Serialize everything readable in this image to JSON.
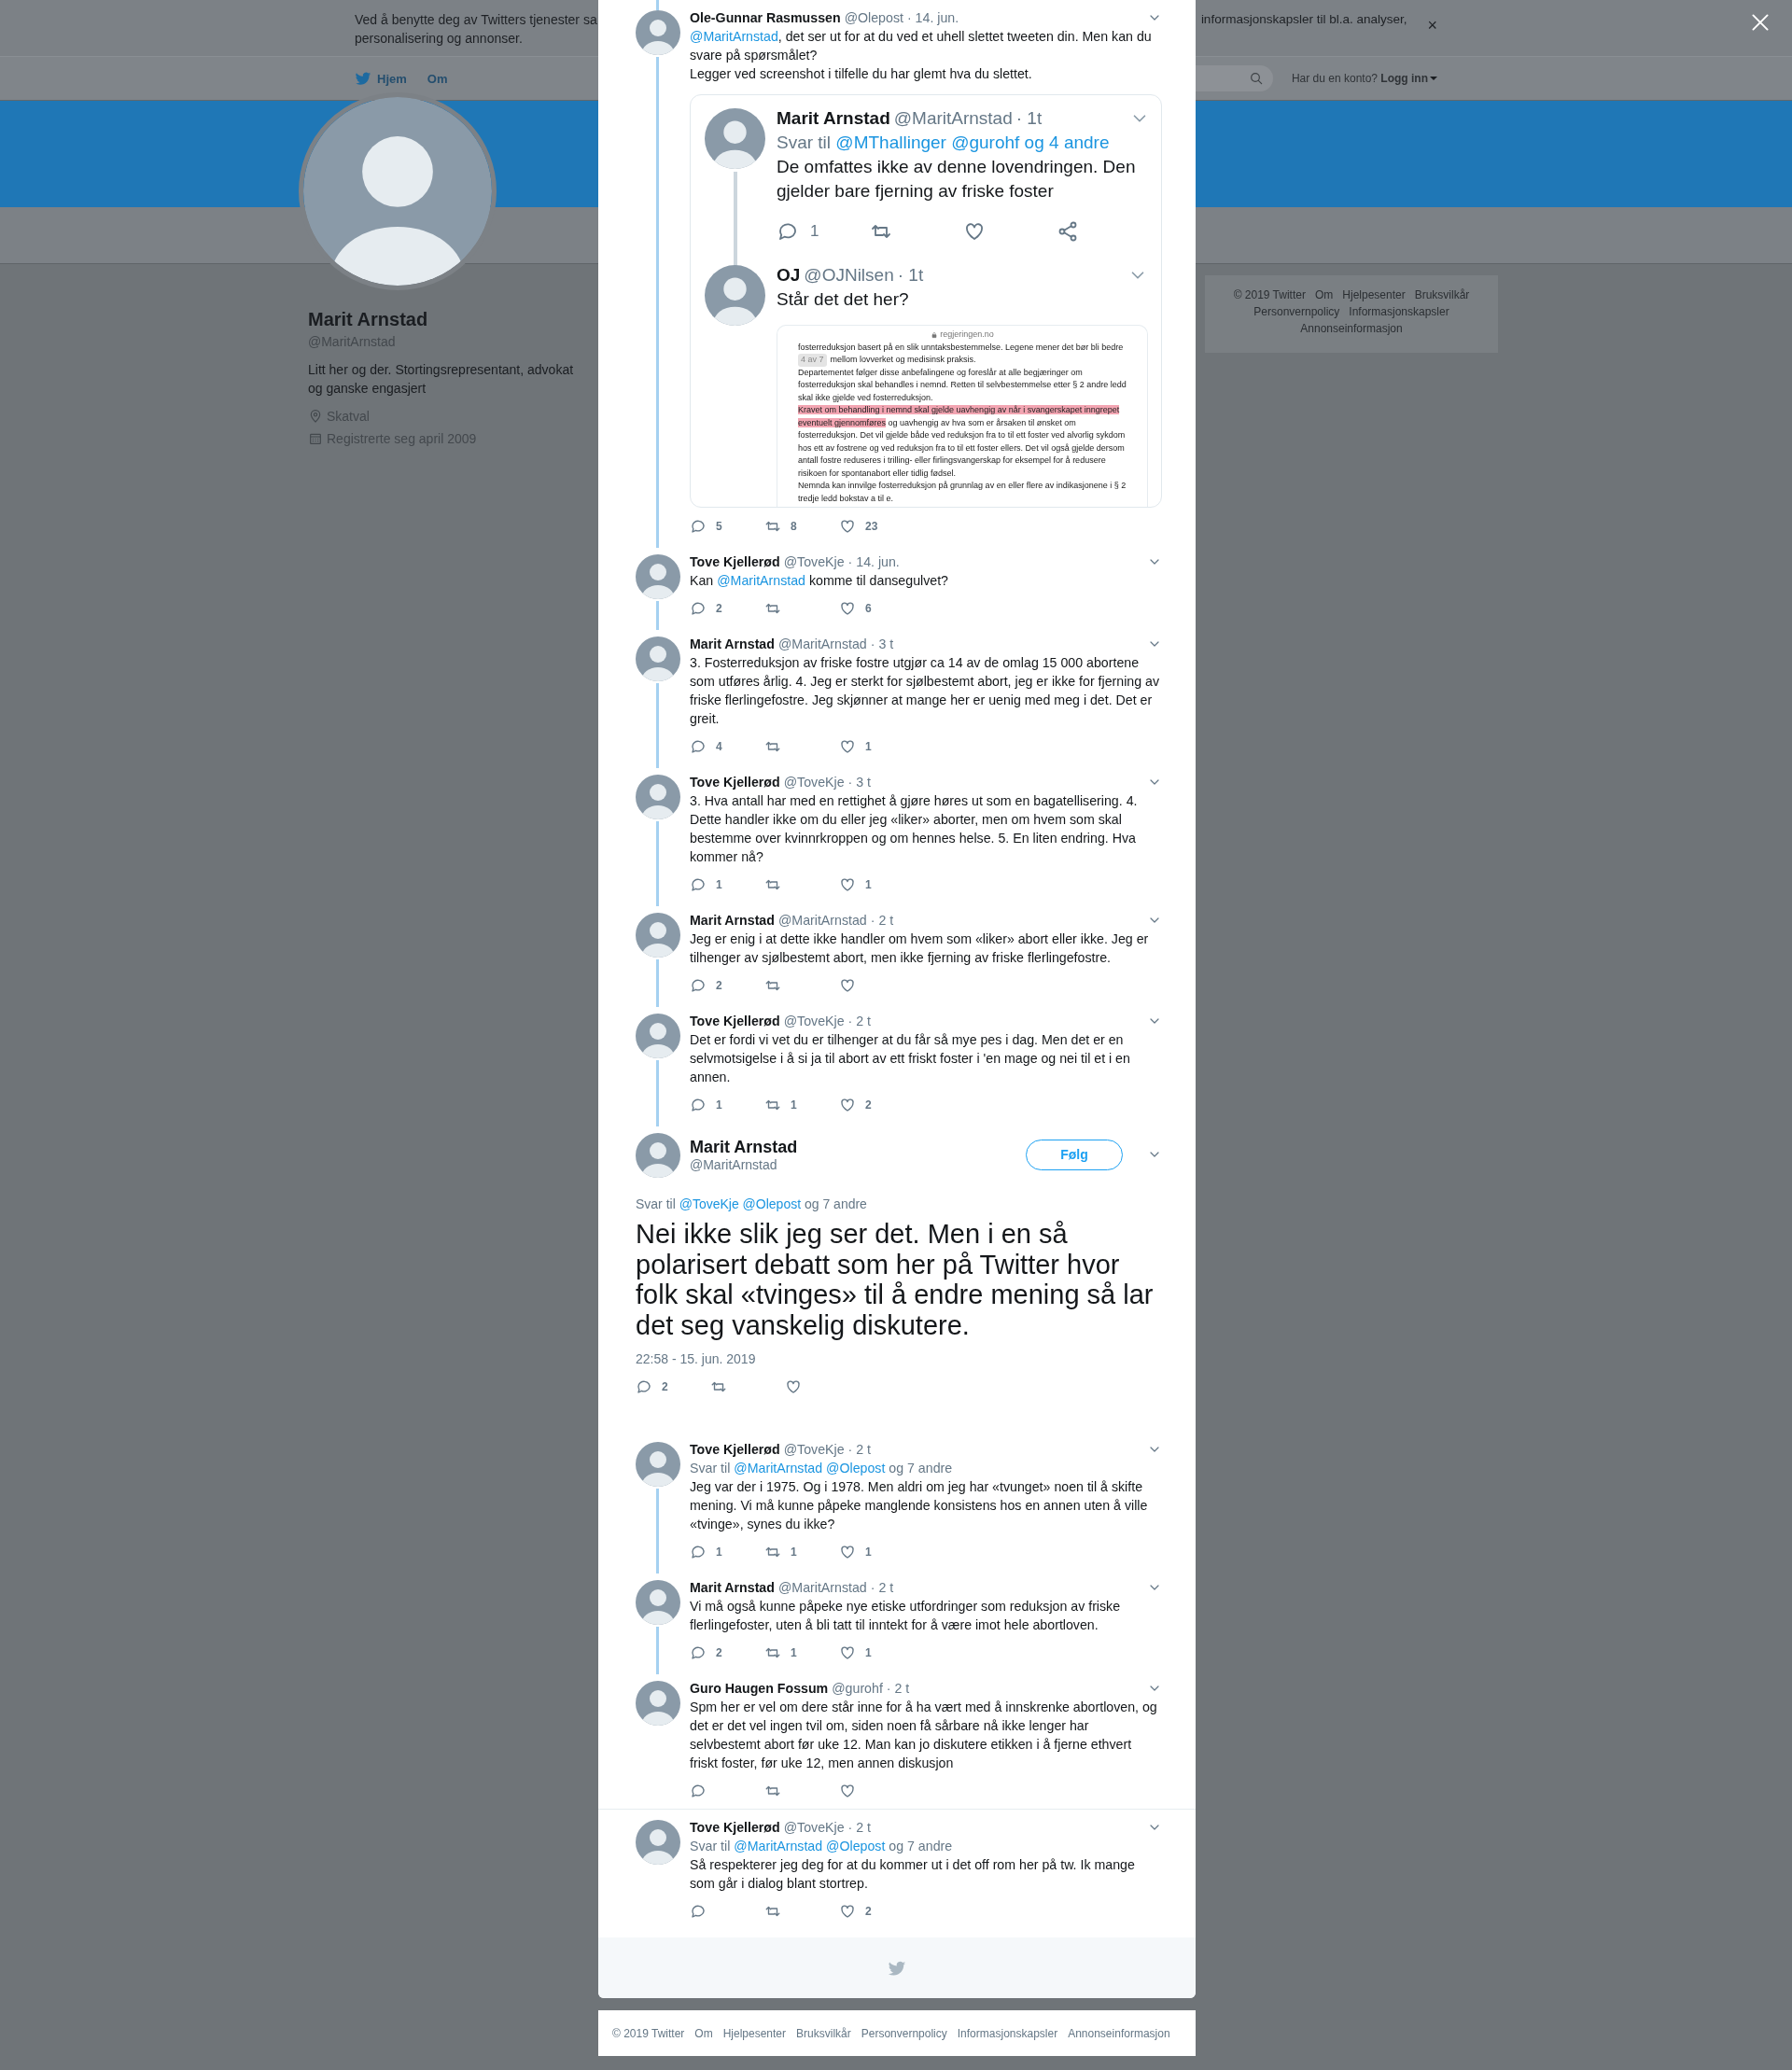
{
  "cookie_banner": {
    "line_1": "Ved å benytte deg av Twitters tjenester sa",
    "line_2": "personalisering og annonser.",
    "right_text": "informasjonskapsler til bl.a. analyser,",
    "close": "×"
  },
  "nav": {
    "home": "Hjem",
    "about": "Om",
    "account_prompt": "Har du en konto?",
    "login": "Logg inn"
  },
  "profile": {
    "name": "Marit Arnstad",
    "handle": "@MaritArnstad",
    "bio": "Litt her og der. Stortingsrepresentant, advokat og ganske engasjert",
    "location": "Skatval",
    "joined": "Registrerte seg april 2009"
  },
  "side_footer": {
    "links": [
      "© 2019 Twitter",
      "Om",
      "Hjelpesenter",
      "Bruksvilkår",
      "Personvernpolicy",
      "Informasjonskapsler",
      "Annonseinformasjon"
    ]
  },
  "thread": [
    {
      "name": "Ole-Gunnar Rasmussen",
      "handle": "@Olepost",
      "time": "· 14. jun.",
      "continued_from_above": true,
      "connected": true,
      "text": [
        {
          "kind": "mention",
          "text": "@MaritArnstad"
        },
        {
          "kind": "plain",
          "text": ", det ser ut for at du ved et uhell slettet tweeten din. Men kan du svare på spørsmålet?\nLegger ved screenshot i tilfelle du har glemt hva du slettet."
        }
      ],
      "media": {
        "kind": "screenshot",
        "tweets": [
          {
            "name": "Marit Arnstad",
            "handle": "@MaritArnstad",
            "time": "· 1t",
            "reply_to": [
              {
                "kind": "plain",
                "text": "Svar til "
              },
              {
                "kind": "mention",
                "text": "@MThallinger @gurohf og 4 andre"
              }
            ],
            "text": "De omfattes ikke av denne lovendringen. Den gjelder bare fjerning av friske foster",
            "replies": "1",
            "connected": true
          },
          {
            "name": "OJ",
            "handle": "@OJNilsen",
            "time": "· 1t",
            "text": "Står det det her?",
            "connected": false,
            "document": {
              "url": "regjeringen.no",
              "paragraphs": [
                {
                  "segments": [
                    {
                      "text": "fosterreduksjon basert på en slik unntaksbestemmelse. Legene mener det bør bli bedre",
                      "highlighted": false
                    }
                  ]
                },
                {
                  "badge": "4 av 7",
                  "segments": [
                    {
                      "text": "mellom lovverket og medisinsk praksis.",
                      "highlighted": false
                    }
                  ]
                },
                {
                  "segments": [
                    {
                      "text": "Departementet følger disse anbefalingene og foreslår at alle begjæringer om fosterreduksjon skal behandles i nemnd. Retten til selvbestemmelse etter § 2 andre ledd skal ikke gjelde ved fosterreduksjon.",
                      "highlighted": false
                    }
                  ]
                },
                {
                  "segments": [
                    {
                      "text": "Kravet om behandling i nemnd skal gjelde uavhengig av når i svangerskapet inngrepet eventuelt gjennomføres",
                      "highlighted": true
                    },
                    {
                      "text": " og uavhengig av hva som er årsaken til ønsket om fosterreduksjon. Det vil gjelde både ved reduksjon fra to til ett foster ved alvorlig sykdom hos ett av fostrene og ved reduksjon fra to til ett foster ellers. Det vil også gjelde dersom antall fostre reduseres i trilling- eller firlingsvangerskap for eksempel for å redusere risikoen for spontanabort eller tidlig fødsel.",
                      "highlighted": false
                    }
                  ]
                },
                {
                  "segments": [
                    {
                      "text": "Nemnda kan innvilge fosterreduksjon på grunnlag av en eller flere av indikasjonene i § 2 tredje ledd bokstav a til e.",
                      "highlighted": false
                    }
                  ]
                }
              ]
            }
          }
        ]
      },
      "replies": "5",
      "retweets": "8",
      "likes": "23"
    },
    {
      "name": "Tove Kjellerød",
      "handle": "@ToveKje",
      "time": "· 14. jun.",
      "connected": true,
      "text": [
        {
          "kind": "plain",
          "text": "Kan "
        },
        {
          "kind": "mention",
          "text": "@MaritArnstad"
        },
        {
          "kind": "plain",
          "text": " komme til dansegulvet?"
        }
      ],
      "replies": "2",
      "likes": "6"
    },
    {
      "name": "Marit Arnstad",
      "handle": "@MaritArnstad",
      "time": "· 3 t",
      "connected": true,
      "text": [
        {
          "kind": "plain",
          "text": "3. Fosterreduksjon av friske fostre utgjør ca 14 av de omlag 15 000 abortene som utføres årlig. 4. Jeg er sterkt for sjølbestemt abort, jeg er ikke for fjerning av friske flerlingefostre. Jeg skjønner at mange her er uenig med meg i det. Det er greit."
        }
      ],
      "replies": "4",
      "likes": "1"
    },
    {
      "name": "Tove Kjellerød",
      "handle": "@ToveKje",
      "time": "· 3 t",
      "connected": true,
      "text": [
        {
          "kind": "plain",
          "text": "3. Hva antall har med en rettighet å gjøre høres ut som en bagatellisering. 4. Dette handler ikke om du eller jeg «liker» aborter, men om hvem som skal bestemme over kvinnrkroppen og om hennes helse. 5. En liten endring. Hva kommer nå?"
        }
      ],
      "replies": "1",
      "likes": "1"
    },
    {
      "name": "Marit Arnstad",
      "handle": "@MaritArnstad",
      "time": "· 2 t",
      "connected": true,
      "text": [
        {
          "kind": "plain",
          "text": "Jeg er enig i at dette ikke handler om hvem som «liker» abort eller ikke. Jeg er tilhenger av sjølbestemt abort, men ikke fjerning av friske flerlingefostre."
        }
      ],
      "replies": "2"
    },
    {
      "name": "Tove Kjellerød",
      "handle": "@ToveKje",
      "time": "· 2 t",
      "connected": true,
      "text": [
        {
          "kind": "plain",
          "text": "Det er fordi vi vet du er tilhenger at du får så mye pes i dag. Men det er en selvmotsigelse i å si ja til abort av ett friskt foster i 'en mage og nei til et i en annen."
        }
      ],
      "replies": "1",
      "retweets": "1",
      "likes": "2"
    }
  ],
  "focused_tweet": {
    "name": "Marit Arnstad",
    "handle": "@MaritArnstad",
    "follow": "Følg",
    "reply_to": [
      {
        "kind": "plain",
        "text": "Svar til "
      },
      {
        "kind": "mention",
        "text": "@ToveKje @Olepost"
      },
      {
        "kind": "plain",
        "text": " og 7 andre"
      }
    ],
    "text": "Nei ikke slik jeg ser det. Men i en så polarisert debatt som her på Twitter hvor folk skal «tvinges» til å endre mening så lar det seg vanskelig diskutere.",
    "timestamp": "22:58 - 15. jun. 2019",
    "replies": "2"
  },
  "replies": [
    {
      "name": "Tove Kjellerød",
      "handle": "@ToveKje",
      "time": "· 2 t",
      "connected": true,
      "reply_to": [
        {
          "kind": "plain",
          "text": "Svar til "
        },
        {
          "kind": "mention",
          "text": "@MaritArnstad @Olepost"
        },
        {
          "kind": "plain",
          "text": " og 7 andre"
        }
      ],
      "text": [
        {
          "kind": "plain",
          "text": "Jeg var der i 1975. Og i 1978. Men aldri om jeg har «tvunget» noen til å skifte mening. Vi må kunne påpeke manglende konsistens hos en annen uten å ville «tvinge», synes du ikke?"
        }
      ],
      "replies": "1",
      "retweets": "1",
      "likes": "1"
    },
    {
      "name": "Marit Arnstad",
      "handle": "@MaritArnstad",
      "time": "· 2 t",
      "connected": true,
      "text": [
        {
          "kind": "plain",
          "text": "Vi må også kunne påpeke nye etiske utfordringer som reduksjon av friske flerlingefoster, uten å bli tatt til inntekt for å være imot hele abortloven."
        }
      ],
      "replies": "2",
      "retweets": "1",
      "likes": "1"
    },
    {
      "name": "Guro Haugen Fossum",
      "handle": "@gurohf",
      "time": "· 2 t",
      "connected": false,
      "divider_below": true,
      "text": [
        {
          "kind": "plain",
          "text": "Spm her er vel om dere står inne for å ha vært med å innskrenke abortloven, og det er det vel ingen tvil om, siden noen få sårbare nå ikke lenger har selvbestemt abort før uke 12. Man kan jo diskutere etikken i å fjerne ethvert friskt foster, før uke 12, men annen diskusjon"
        }
      ]
    },
    {
      "name": "Tove Kjellerød",
      "handle": "@ToveKje",
      "time": "· 2 t",
      "connected": false,
      "reply_to": [
        {
          "kind": "plain",
          "text": "Svar til "
        },
        {
          "kind": "mention",
          "text": "@MaritArnstad @Olepost"
        },
        {
          "kind": "plain",
          "text": " og 7 andre"
        }
      ],
      "text": [
        {
          "kind": "plain",
          "text": "Så respekterer jeg deg for at du kommer ut i det off rom her på tw. Ik mange som går i dialog blant stortrep."
        }
      ],
      "likes": "2"
    }
  ],
  "page_footer": {
    "links": [
      "© 2019 Twitter",
      "Om",
      "Hjelpesenter",
      "Bruksvilkår",
      "Personvernpolicy",
      "Informasjonskapsler",
      "Annonseinformasjon"
    ]
  }
}
